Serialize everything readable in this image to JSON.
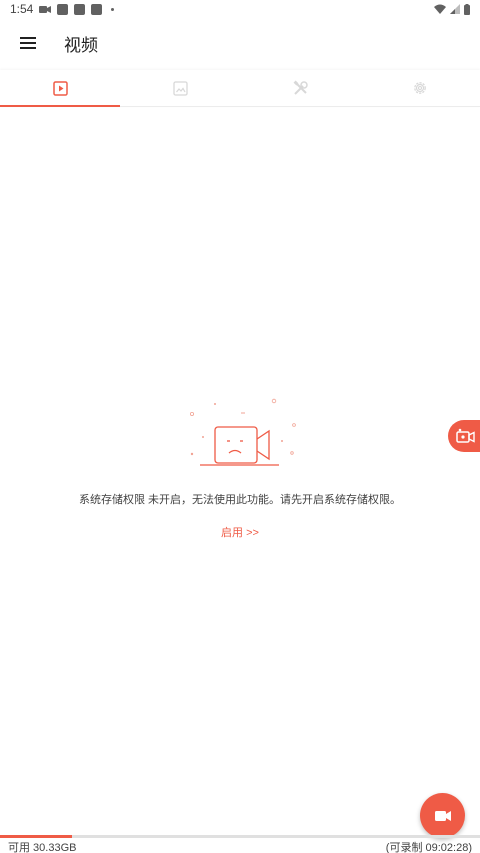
{
  "status_bar": {
    "time": "1:54"
  },
  "app_bar": {
    "title": "视频"
  },
  "tabs": [
    {
      "name": "video",
      "icon": "video-play-icon",
      "active": true
    },
    {
      "name": "image",
      "icon": "image-icon",
      "active": false
    },
    {
      "name": "tools",
      "icon": "tools-icon",
      "active": false
    },
    {
      "name": "settings",
      "icon": "gear-icon",
      "active": false
    }
  ],
  "empty_state": {
    "message": "系统存储权限 未开启，无法使用此功能。请先开启系统存储权限。",
    "enable_label": "启用 >>"
  },
  "storage": {
    "available": "可用 30.33GB",
    "recordable": "(可录制 09:02:28)",
    "used_fraction": 0.15
  },
  "colors": {
    "accent": "#ef5b46",
    "tab_inactive": "#d8d8d8",
    "text": "#212121"
  }
}
